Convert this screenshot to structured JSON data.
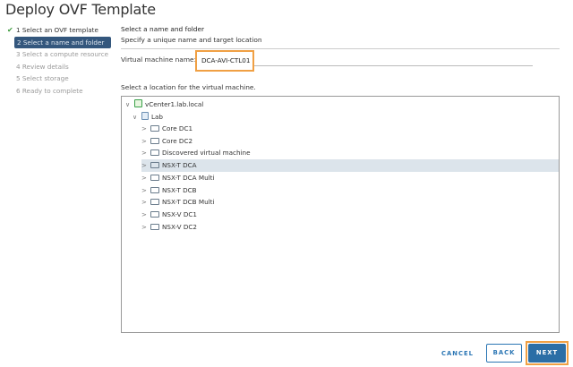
{
  "title": "Deploy OVF Template",
  "steps": [
    {
      "label": "1 Select an OVF template",
      "state": "done"
    },
    {
      "label": "2 Select a name and folder",
      "state": "active"
    },
    {
      "label": "3 Select a compute resource",
      "state": "pending"
    },
    {
      "label": "4 Review details",
      "state": "pending"
    },
    {
      "label": "5 Select storage",
      "state": "pending"
    },
    {
      "label": "6 Ready to complete",
      "state": "pending"
    }
  ],
  "content": {
    "heading": "Select a name and folder",
    "subheading": "Specify a unique name and target location",
    "vm_name_label": "Virtual machine name:",
    "vm_name_value": "DCA-AVI-CTL01",
    "location_label": "Select a location for the virtual machine."
  },
  "tree": {
    "root": "vCenter1.lab.local",
    "datacenter": "Lab",
    "folders": [
      "Core DC1",
      "Core DC2",
      "Discovered virtual machine",
      "NSX-T DCA",
      "NSX-T DCA Multi",
      "NSX-T DCB",
      "NSX-T DCB Multi",
      "NSX-V DC1",
      "NSX-V DC2"
    ],
    "selected": "NSX-T DCA"
  },
  "buttons": {
    "cancel": "CANCEL",
    "back": "BACK",
    "next": "NEXT"
  },
  "colors": {
    "accent": "#2b6ea6",
    "highlight": "#f0a044",
    "active_step": "#34577d"
  }
}
